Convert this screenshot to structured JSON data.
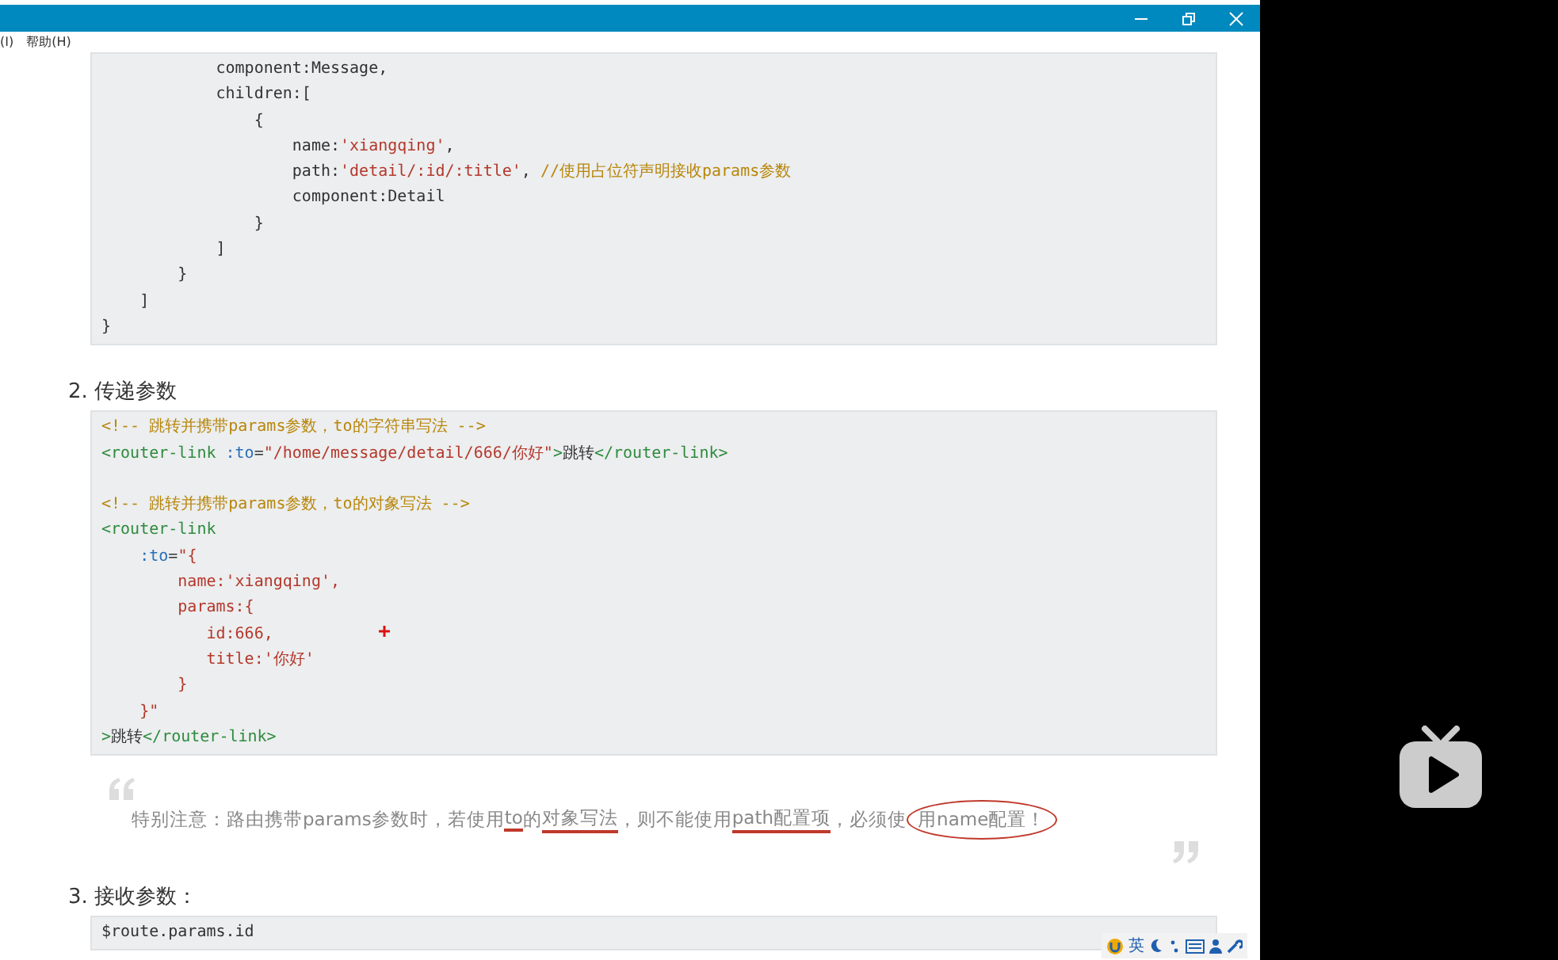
{
  "menu": [
    {
      "label": "(I)"
    },
    {
      "label": "帮助(H)"
    }
  ],
  "blocks": [
    {
      "kind": "code",
      "lines": [
        [
          {
            "kind": "plain",
            "text": "            component:Message,"
          }
        ],
        [
          {
            "kind": "plain",
            "text": "            children:["
          }
        ],
        [
          {
            "kind": "plain",
            "text": "                {"
          }
        ],
        [
          {
            "kind": "plain",
            "text": "                    name:"
          },
          {
            "kind": "string",
            "text": "'xiangqing'"
          },
          {
            "kind": "plain",
            "text": ","
          }
        ],
        [
          {
            "kind": "plain",
            "text": "                    path:"
          },
          {
            "kind": "string",
            "text": "'detail/:id/:title'"
          },
          {
            "kind": "plain",
            "text": ", "
          },
          {
            "kind": "comment",
            "text": "//使用占位符声明接收params参数"
          }
        ],
        [
          {
            "kind": "plain",
            "text": "                    component:Detail"
          }
        ],
        [
          {
            "kind": "plain",
            "text": "                }"
          }
        ],
        [
          {
            "kind": "plain",
            "text": "            ]"
          }
        ],
        [
          {
            "kind": "plain",
            "text": "        }"
          }
        ],
        [
          {
            "kind": "plain",
            "text": "    ]"
          }
        ],
        [
          {
            "kind": "plain",
            "text": "}"
          }
        ]
      ]
    },
    {
      "kind": "heading",
      "text": "2. 传递参数"
    },
    {
      "kind": "code",
      "lines": [
        [
          {
            "kind": "comment",
            "text": "<!-- 跳转并携带params参数，to的字符串写法 -->"
          }
        ],
        [
          {
            "kind": "tag",
            "text": "<router-link"
          },
          {
            "kind": "attr",
            "text": " :to"
          },
          {
            "kind": "plain",
            "text": "="
          },
          {
            "kind": "string",
            "text": "\"/home/message/detail/666/你好\""
          },
          {
            "kind": "tag",
            "text": ">"
          },
          {
            "kind": "plain",
            "text": "跳转"
          },
          {
            "kind": "tag",
            "text": "</router-link>"
          }
        ],
        [
          {
            "kind": "comment",
            "text": "<!-- 跳转并携带params参数，to的对象写法 -->",
            "blank_before": true
          }
        ],
        [
          {
            "kind": "tag",
            "text": "<router-link"
          }
        ],
        [
          {
            "kind": "attr",
            "text": "    :to"
          },
          {
            "kind": "plain",
            "text": "="
          },
          {
            "kind": "string",
            "text": "\"{"
          }
        ],
        [
          {
            "kind": "string",
            "text": "        name:'xiangqing',"
          }
        ],
        [
          {
            "kind": "string",
            "text": "        params:{"
          }
        ],
        [
          {
            "kind": "string",
            "text": "           id:666,"
          }
        ],
        [
          {
            "kind": "string",
            "text": "           title:'你好'"
          }
        ],
        [
          {
            "kind": "string",
            "text": "        }"
          }
        ],
        [
          {
            "kind": "string",
            "text": "    }\""
          }
        ],
        [
          {
            "kind": "tag",
            "text": ">"
          },
          {
            "kind": "plain",
            "text": "跳转"
          },
          {
            "kind": "tag",
            "text": "</router-link>"
          }
        ]
      ]
    },
    {
      "kind": "quote",
      "segments": [
        {
          "text": "特别注意：路由携带params参数时，若使用",
          "underlined": false,
          "circled": false
        },
        {
          "text": "to",
          "underlined": true,
          "circled": false
        },
        {
          "text": "的",
          "underlined": false,
          "circled": false
        },
        {
          "text": "对象写法",
          "underlined": true,
          "circled": false
        },
        {
          "text": "，则不能使用",
          "underlined": false,
          "circled": false
        },
        {
          "text": "path配置项",
          "underlined": true,
          "circled": false
        },
        {
          "text": "，必须使",
          "underlined": false,
          "circled": false
        },
        {
          "text": "用name配置！",
          "underlined": false,
          "circled": true
        }
      ]
    },
    {
      "kind": "heading",
      "text": "3. 接收参数："
    },
    {
      "kind": "code",
      "lines": [
        [
          {
            "kind": "plain",
            "text": "$route.params.id"
          }
        ]
      ]
    }
  ],
  "tray": {
    "language": "英"
  }
}
